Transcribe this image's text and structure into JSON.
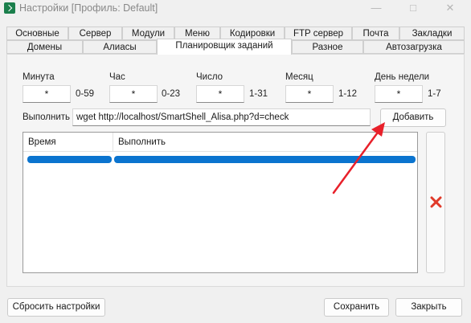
{
  "window": {
    "title": "Настройки [Профиль: Default]"
  },
  "tabs_top": [
    "Основные",
    "Сервер",
    "Модули",
    "Меню",
    "Кодировки",
    "FTP сервер",
    "Почта",
    "Закладки"
  ],
  "tabs_bottom": [
    "Домены",
    "Алиасы",
    "Планировщик заданий",
    "Разное",
    "Автозагрузка"
  ],
  "active_tab": "Планировщик заданий",
  "schedule": {
    "minute": {
      "label": "Минута",
      "value": "*",
      "range": "0-59"
    },
    "hour": {
      "label": "Час",
      "value": "*",
      "range": "0-23"
    },
    "day": {
      "label": "Число",
      "value": "*",
      "range": "1-31"
    },
    "month": {
      "label": "Месяц",
      "value": "*",
      "range": "1-12"
    },
    "weekday": {
      "label": "День недели",
      "value": "*",
      "range": "1-7"
    }
  },
  "command": {
    "label": "Выполнить",
    "value": "wget http://localhost/SmartShell_Alisa.php?d=check"
  },
  "add_button": "Добавить",
  "table": {
    "columns": [
      "Время",
      "Выполнить"
    ]
  },
  "buttons": {
    "reset": "Сбросить настройки",
    "save": "Сохранить",
    "close": "Закрыть"
  },
  "colors": {
    "accent": "#0b74cf",
    "arrow": "#e8202a",
    "delete": "#e03a2a"
  },
  "icons": {
    "delete": "delete-x-icon",
    "arrow": "red-arrow-annotation"
  }
}
